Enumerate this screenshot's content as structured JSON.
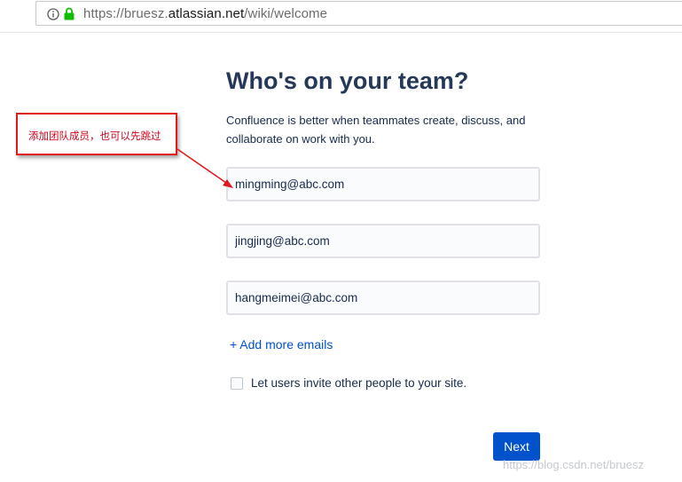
{
  "browser": {
    "url_prefix": "https://bruesz.",
    "url_host": "atlassian.net",
    "url_path": "/wiki/welcome"
  },
  "main": {
    "title": "Who's on your team?",
    "description": "Confluence is better when teammates create, discuss, and collaborate on work with you.",
    "emails": [
      "mingming@abc.com",
      "jingjing@abc.com",
      "hangmeimei@abc.com"
    ],
    "add_more_label": "+ Add more emails",
    "invite_checkbox_label": "Let users invite other people to your site.",
    "invite_checkbox_checked": false,
    "next_label": "Next"
  },
  "annotation": {
    "text": "添加团队成员，也可以先跳过"
  },
  "watermark": "https://blog.csdn.net/bruesz",
  "colors": {
    "primary": "#0052cc",
    "title": "#253858",
    "annotation_red": "#e0191e",
    "secure_lock": "#12bc00"
  }
}
